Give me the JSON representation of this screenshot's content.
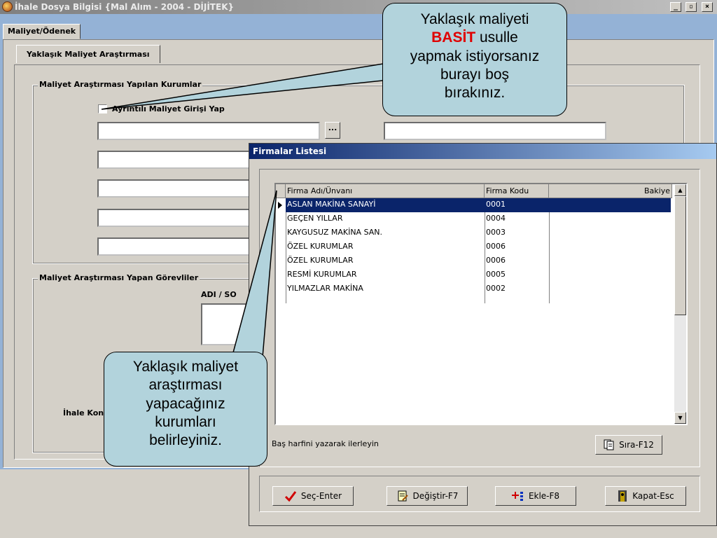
{
  "window": {
    "title": "İhale Dosya Bilgisi   {Mal Alım - 2004 - DİJİTEK}",
    "min": "_",
    "max": "▫",
    "close": "×"
  },
  "tabs": {
    "main_tab": "Maliyet/Ödenek",
    "sub_tab": "Yaklaşık Maliyet Araştırması"
  },
  "group1": {
    "label": "Maliyet Araştırması Yapılan Kurumlar",
    "checkbox_label": "Ayrıntılı Maliyet Girişi Yap",
    "browse_button": "..."
  },
  "group2": {
    "label": "Maliyet Araştırması Yapan Görevliler",
    "column_label": "ADI / SO",
    "ihale_label": "İhale Kon"
  },
  "dialog": {
    "title": "Firmalar Listesi",
    "columns": [
      "Firma Adı/Ünvanı",
      "Firma Kodu",
      "Bakiye"
    ],
    "rows": [
      {
        "name": "ASLAN MAKİNA SANAYİ",
        "code": "0001"
      },
      {
        "name": "GEÇEN YILLAR",
        "code": "0004"
      },
      {
        "name": "KAYGUSUZ MAKİNA SAN.",
        "code": "0003"
      },
      {
        "name": "ÖZEL KURUMLAR",
        "code": "0006"
      },
      {
        "name": "ÖZEL KURUMLAR",
        "code": "0006"
      },
      {
        "name": "RESMİ KURUMLAR",
        "code": "0005"
      },
      {
        "name": "YILMAZLAR MAKİNA",
        "code": "0002"
      }
    ],
    "hint": "Baş harfini yazarak ilerleyin",
    "sort_button": "Sıra-F12",
    "buttons": {
      "select": "Seç-Enter",
      "change": "Değiştir-F7",
      "add": "Ekle-F8",
      "close": "Kapat-Esc"
    }
  },
  "callout_top": {
    "line1": "Yaklaşık maliyeti",
    "emph": "BASİT",
    "line2": " usulle",
    "line3": "yapmak istiyorsanız",
    "line4": "burayı boş",
    "line5": "bırakınız."
  },
  "callout_bottom": {
    "line1": "Yaklaşık maliyet",
    "line2": "araştırması",
    "line3": "yapacağınız",
    "line4": "kurumları",
    "line5": "belirleyiniz."
  },
  "colors": {
    "accent": "#e00000",
    "selection": "#0a246a",
    "callout_bg": "#b2d3dc"
  }
}
